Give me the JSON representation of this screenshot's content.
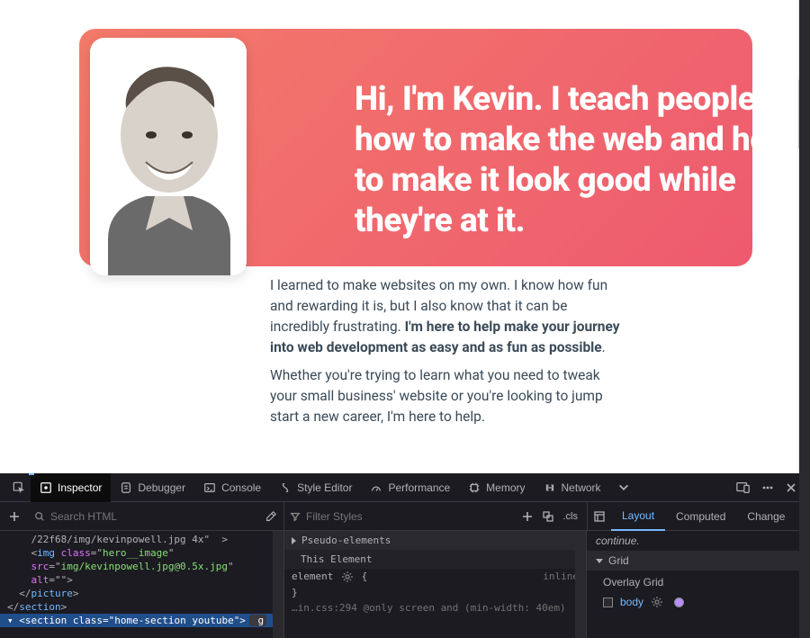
{
  "hero": {
    "title": "Hi, I'm Kevin. I teach people how to make the web and how to make it look good while they're at it."
  },
  "paragraphs": {
    "p1_a": "I learned to make websites on my own. I know how fun and rewarding it is, but I also know that it can be incredibly frustrating. ",
    "p1_b": "I'm here to help make your journey into web development as easy and as fun as possible",
    "p1_c": ".",
    "p2": "Whether you're trying to learn what you need to tweak your small business' website or you're looking to jump start a new career, I'm here to help."
  },
  "devtools": {
    "tabs": {
      "inspector": "Inspector",
      "debugger": "Debugger",
      "console": "Console",
      "style_editor": "Style Editor",
      "performance": "Performance",
      "memory": "Memory",
      "network": "Network"
    },
    "search_placeholder": "Search HTML",
    "filter_placeholder": "Filter Styles",
    "cls_label": ".cls",
    "side_tabs": {
      "layout": "Layout",
      "computed": "Computed",
      "changes": "Change"
    },
    "dom": {
      "l1": "    /22f68/img/kevinpowell.jpg 4x\"  >",
      "l2a": "    <",
      "l2b": "img",
      "l2c": " class",
      "l2d": "=\"",
      "l2e": "hero__image",
      "l2f": "\"",
      "l3a": "    src",
      "l3b": "=\"",
      "l3c": "img/kevinpowell.jpg@0.5x.jpg",
      "l3d": "\"",
      "l4a": "    alt",
      "l4b": "=\"\">",
      "l5a": "  </",
      "l5b": "picture",
      "l5c": ">",
      "l6a": "</",
      "l6b": "section",
      "l6c": ">",
      "l7a": "<",
      "l7b": "section",
      "l7c": " class",
      "l7d": "=\"",
      "l7e": "home-section youtube",
      "l7f": "\">",
      "l7g": " g"
    },
    "styles": {
      "pseudo": "Pseudo-elements",
      "this_element": "This Element",
      "rule1": "element",
      "rule1_brace": " {",
      "rule1_src": "inline",
      "rule1_close": "}",
      "media": "…in.css:294 @only screen and (min-width: 40em)"
    },
    "layout": {
      "continue": "continue.",
      "grid": "Grid",
      "overlay": "Overlay Grid",
      "body": "body"
    }
  }
}
